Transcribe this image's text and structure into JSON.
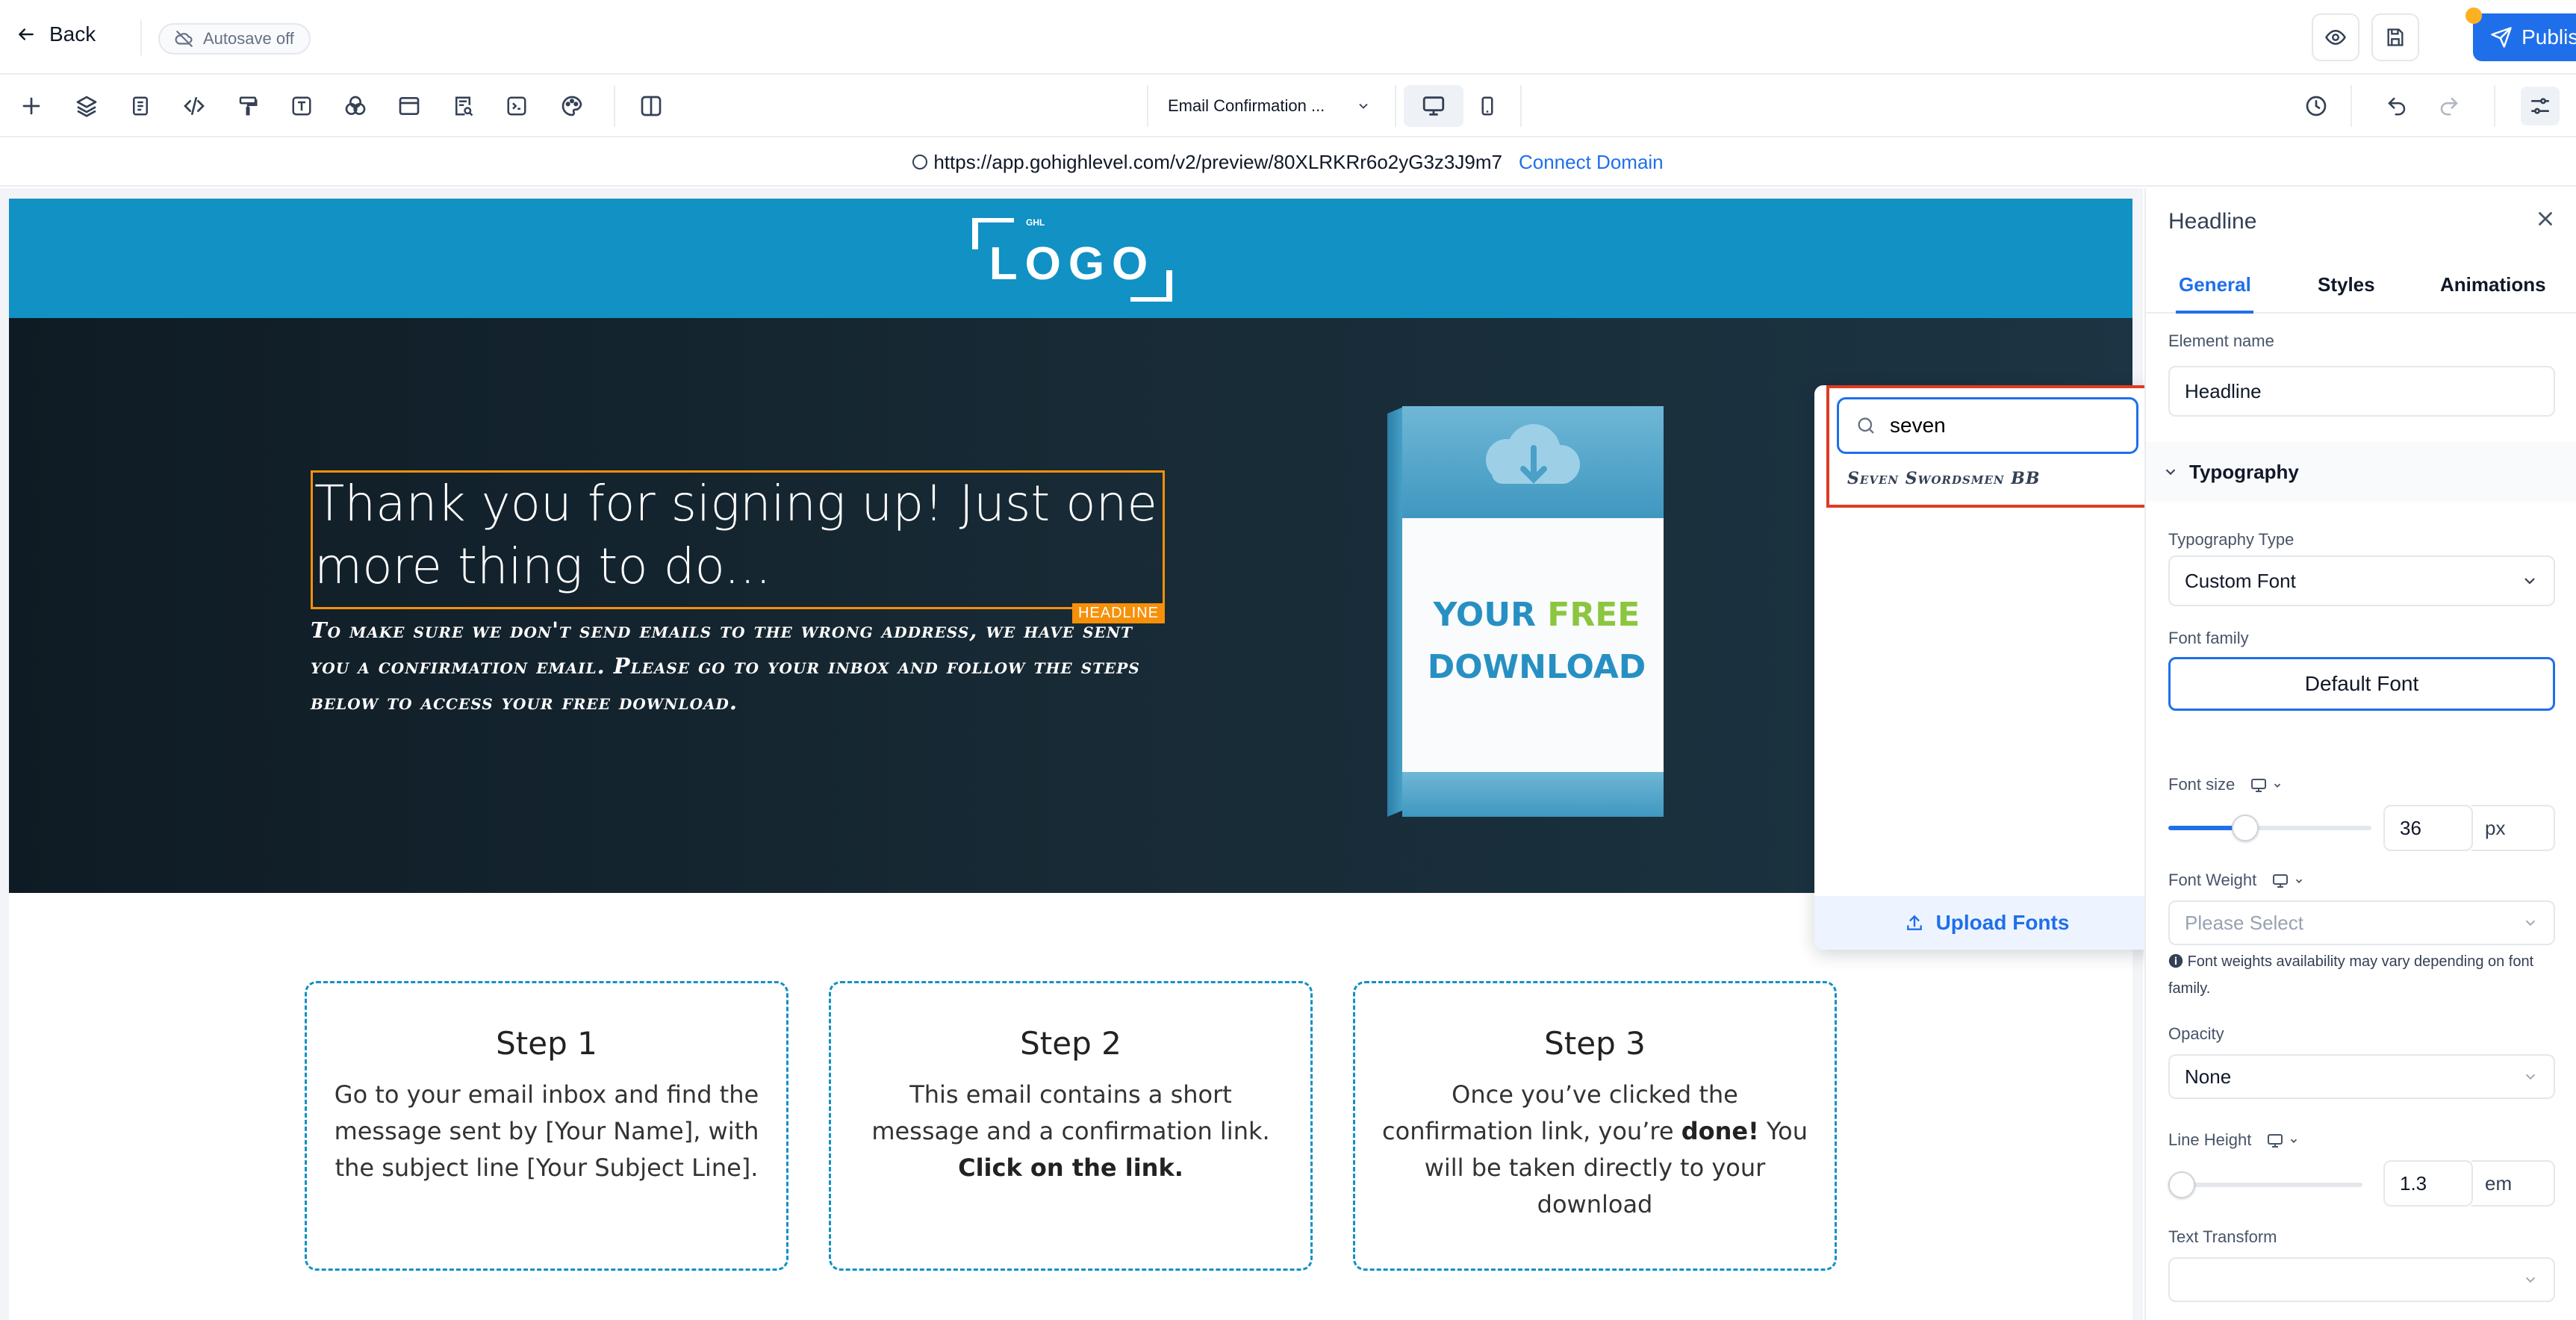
{
  "topbar": {
    "back_label": "Back",
    "autosave_label": "Autosave off",
    "publish_label": "Publish"
  },
  "toolbar": {
    "tools": [
      "add-icon",
      "layers-icon",
      "pages-icon",
      "code-icon",
      "paint-roller-icon",
      "text-icon",
      "color-icon",
      "layout-icon",
      "form-icon",
      "terminal-icon",
      "palette-icon",
      "split-view-icon"
    ],
    "page_select": "Email Confirmation ...",
    "devices": [
      "desktop",
      "mobile"
    ]
  },
  "urlbar": {
    "url": "https://app.gohighlevel.com/v2/preview/80XLRKRr6o2yG3z3J9m7",
    "connect_label": "Connect Domain"
  },
  "page": {
    "logo_small": "GHL",
    "logo_text": "LOGO",
    "headline": "Thank you for signing up! Just one more thing to do...",
    "headline_tag": "HEADLINE",
    "subtext": "To make sure we don't send emails to the wrong address, we have sent you a confirmation email. Please go to your inbox and follow the steps below to access your free download.",
    "book": {
      "line1a": "YOUR",
      "line1b": "FREE",
      "line2": "DOWNLOAD"
    },
    "steps": [
      {
        "title": "Step 1",
        "text": "Go to your email inbox and find the message sent by [Your Name], with the subject line [Your Subject Line]."
      },
      {
        "title": "Step 2",
        "text": "This email contains a short message and a confirmation link.",
        "bold": "Click on the link."
      },
      {
        "title": "Step 3",
        "text_before": "Once you’ve clicked the confirmation link, you’re ",
        "bold": "done!",
        "text_after": " You will be taken directly to your download"
      }
    ]
  },
  "font_dropdown": {
    "search_value": "seven",
    "result": "Seven Swordsmen BB",
    "upload_label": "Upload Fonts"
  },
  "panel": {
    "title": "Headline",
    "tabs": [
      "General",
      "Styles",
      "Animations"
    ],
    "active_tab": "General",
    "element_name_label": "Element name",
    "element_name_value": "Headline",
    "typography_label": "Typography",
    "typography_type_label": "Typography Type",
    "typography_type_value": "Custom Font",
    "font_family_label": "Font family",
    "font_family_value": "Default Font",
    "font_size_label": "Font size",
    "font_size_value": "36",
    "font_size_unit": "px",
    "font_size_slider": 0.38,
    "font_weight_label": "Font Weight",
    "font_weight_placeholder": "Please Select",
    "font_weight_note": "Font weights availability may vary depending on font family.",
    "opacity_label": "Opacity",
    "opacity_value": "None",
    "line_height_label": "Line Height",
    "line_height_value": "1.3",
    "line_height_unit": "em",
    "line_height_slider": 0.02,
    "text_transform_label": "Text Transform",
    "text_transform_value": ""
  },
  "colors": {
    "accent": "#1f6feb",
    "logo_band": "#1191c4",
    "headline_outline": "#f79009",
    "highlight_box": "#e03b24"
  }
}
